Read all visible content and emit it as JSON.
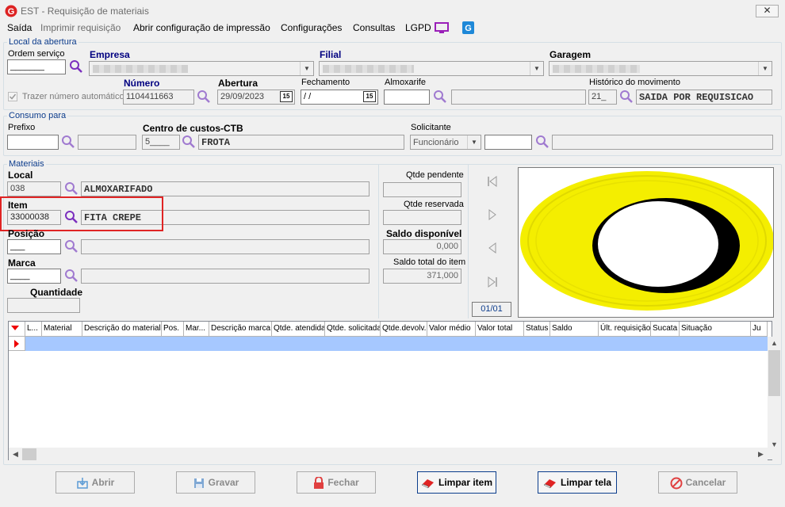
{
  "window": {
    "title": "EST - Requisição de materiais",
    "close": "✕"
  },
  "menu": {
    "saida": "Saída",
    "imprimir": "Imprimir requisição",
    "abrir_config": "Abrir configuração de impressão",
    "configuracoes": "Configurações",
    "consultas": "Consultas",
    "lgpd": "LGPD"
  },
  "abertura": {
    "legend": "Local da abertura",
    "ordem_servico_label": "Ordem serviço",
    "ordem_servico_value": "_______",
    "empresa_label": "Empresa",
    "filial_label": "Filial",
    "garagem_label": "Garagem",
    "trazer_label": "Trazer número automático",
    "numero_label": "Número",
    "numero_value": "1104411663",
    "abertura_label": "Abertura",
    "abertura_value": "29/09/2023",
    "fechamento_label": "Fechamento",
    "fechamento_value": " /  /",
    "almoxarife_label": "Almoxarife",
    "historico_label": "Histórico do movimento",
    "historico_code": "21_",
    "historico_desc": "SAIDA POR REQUISICAO",
    "cal_icon": "15"
  },
  "consumo": {
    "legend": "Consumo para",
    "prefixo_label": "Prefixo",
    "centro_label": "Centro de custos-CTB",
    "centro_code": "5____",
    "centro_desc": "FROTA",
    "solicitante_label": "Solicitante",
    "solicitante_option": "Funcionário"
  },
  "materiais": {
    "legend": "Materiais",
    "local_label": "Local",
    "local_code": "038",
    "local_desc": "ALMOXARIFADO",
    "item_label": "Item",
    "item_code": "33000038",
    "item_desc": "FITA CREPE",
    "posicao_label": "Posição",
    "posicao_value": "___",
    "marca_label": "Marca",
    "marca_value": "____",
    "quantidade_label": "Quantidade",
    "qtde_pendente_label": "Qtde pendente",
    "qtde_reservada_label": "Qtde reservada",
    "saldo_disp_label": "Saldo disponível",
    "saldo_disp_value": "0,000",
    "saldo_total_label": "Saldo total do item",
    "saldo_total_value": "371,000",
    "page_counter": "01/01"
  },
  "grid": {
    "columns": [
      "L...",
      "Material",
      "Descrição do material",
      "Pos.",
      "Mar...",
      "Descrição marca",
      "Qtde. atendida",
      "Qtde. solicitada",
      "Qtde.devolv.",
      "Valor médio",
      "Valor total",
      "Status",
      "Saldo",
      "Últ. requisição",
      "Sucata",
      "Situação",
      "Ju"
    ]
  },
  "buttons": {
    "abrir": "Abrir",
    "gravar": "Gravar",
    "fechar": "Fechar",
    "limpar_item": "Limpar item",
    "limpar_tela": "Limpar tela",
    "cancelar": "Cancelar"
  },
  "colors": {
    "accent": "#0c3c8c",
    "highlight": "#e02424",
    "selection": "#a6c8ff",
    "search": "#7b2fbe"
  },
  "icons": {
    "logo": "app-logo-icon",
    "search": "magnifier-icon",
    "monitor": "monitor-icon",
    "brand": "g-brand-icon"
  }
}
